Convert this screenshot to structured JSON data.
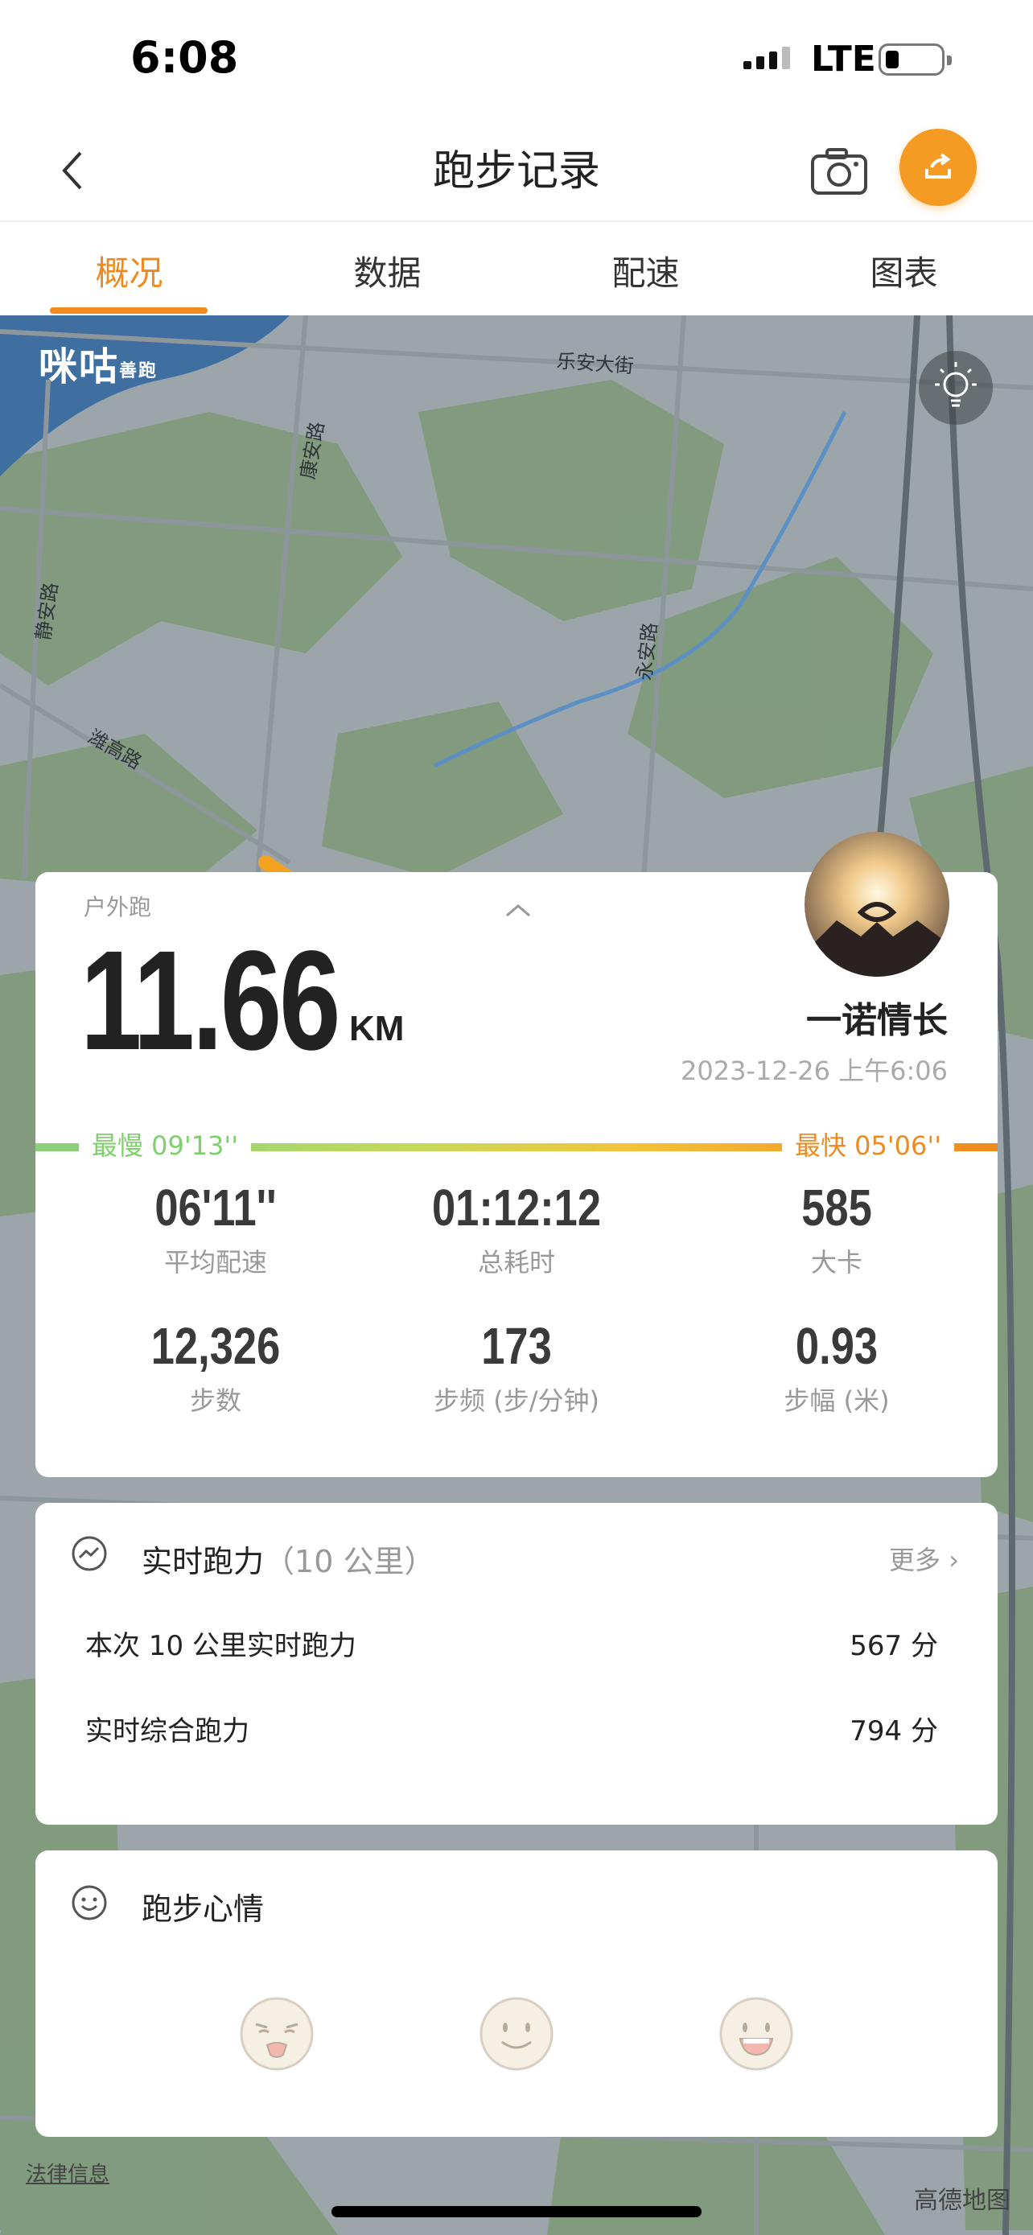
{
  "status_bar": {
    "time": "6:08",
    "network": "LTE"
  },
  "header": {
    "title": "跑步记录"
  },
  "tabs": [
    {
      "label": "概况",
      "active": true
    },
    {
      "label": "数据",
      "active": false
    },
    {
      "label": "配速",
      "active": false
    },
    {
      "label": "图表",
      "active": false
    }
  ],
  "map": {
    "logo": "咪咕",
    "logo_sub": "善跑",
    "labels": [
      "乐安大街",
      "康安路",
      "静安路",
      "永安路",
      "潍高路"
    ],
    "legal": "法律信息",
    "attribution": "高德地图"
  },
  "summary": {
    "sport_type": "户外跑",
    "distance": "11.66",
    "unit": "KM",
    "username": "一诺情长",
    "datetime": "2023-12-26 上午6:06",
    "slowest": "最慢  09'13''",
    "fastest": "最快  05'06''",
    "stats": [
      {
        "value": "06'11''",
        "label": "平均配速"
      },
      {
        "value": "01:12:12",
        "label": "总耗时"
      },
      {
        "value": "585",
        "label": "大卡"
      },
      {
        "value": "12,326",
        "label": "步数"
      },
      {
        "value": "173",
        "label": "步频 (步/分钟)"
      },
      {
        "value": "0.93",
        "label": "步幅 (米)"
      }
    ]
  },
  "run_power": {
    "title": "实时跑力",
    "subtitle": "（10 公里）",
    "more": "更多",
    "rows": [
      {
        "label": "本次 10 公里实时跑力",
        "value": "567 分"
      },
      {
        "label": "实时综合跑力",
        "value": "794 分"
      }
    ]
  },
  "mood": {
    "title": "跑步心情"
  },
  "colors": {
    "accent": "#f08a1e",
    "slow": "#7fcf6a",
    "fast": "#f08a1e"
  }
}
